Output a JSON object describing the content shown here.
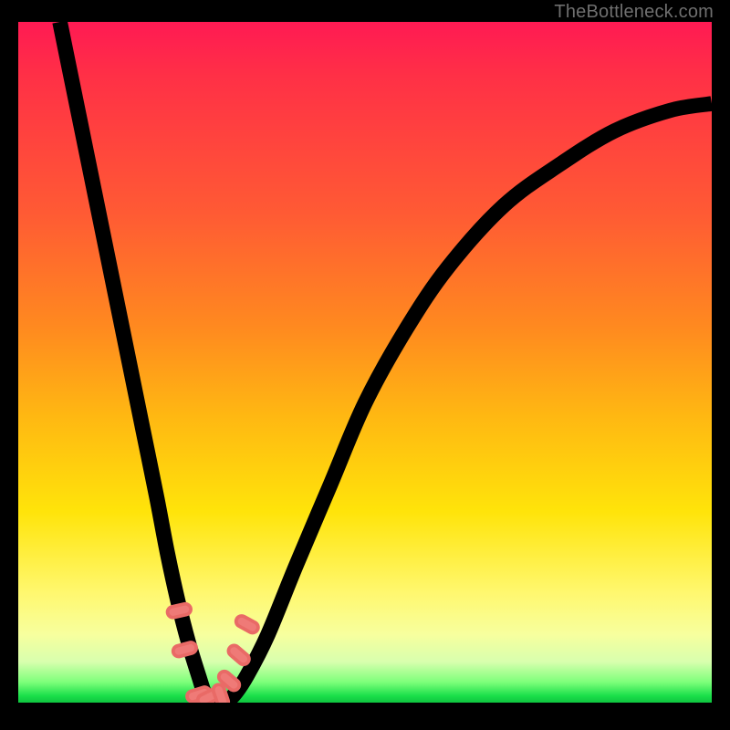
{
  "watermark": "TheBottleneck.com",
  "chart_data": {
    "type": "line",
    "title": "",
    "xlabel": "",
    "ylabel": "",
    "xlim": [
      0,
      100
    ],
    "ylim": [
      0,
      100
    ],
    "series": [
      {
        "name": "bottleneck-curve",
        "x": [
          6,
          8,
          10,
          12,
          14,
          16,
          18,
          20,
          21.5,
          23,
          24.5,
          26,
          27,
          28,
          29.5,
          31,
          33,
          36,
          40,
          45,
          50,
          56,
          62,
          70,
          78,
          86,
          94,
          100
        ],
        "values": [
          100,
          90,
          80,
          70,
          60,
          50,
          40,
          30,
          22,
          15,
          9,
          4,
          1,
          0,
          0,
          1,
          4,
          10,
          20,
          32,
          44,
          55,
          64,
          73,
          79,
          84,
          87,
          88
        ]
      }
    ],
    "markers": [
      {
        "x": 23.2,
        "y": 13.5
      },
      {
        "x": 24.0,
        "y": 7.8
      },
      {
        "x": 26.0,
        "y": 1.2
      },
      {
        "x": 27.5,
        "y": 0.8
      },
      {
        "x": 29.2,
        "y": 1.0
      },
      {
        "x": 30.4,
        "y": 3.2
      },
      {
        "x": 31.8,
        "y": 7.0
      },
      {
        "x": 33.0,
        "y": 11.5
      }
    ],
    "gradient": {
      "top": "#ff1a53",
      "mid": "#ffe40a",
      "bottom": "#0fc43f"
    }
  }
}
